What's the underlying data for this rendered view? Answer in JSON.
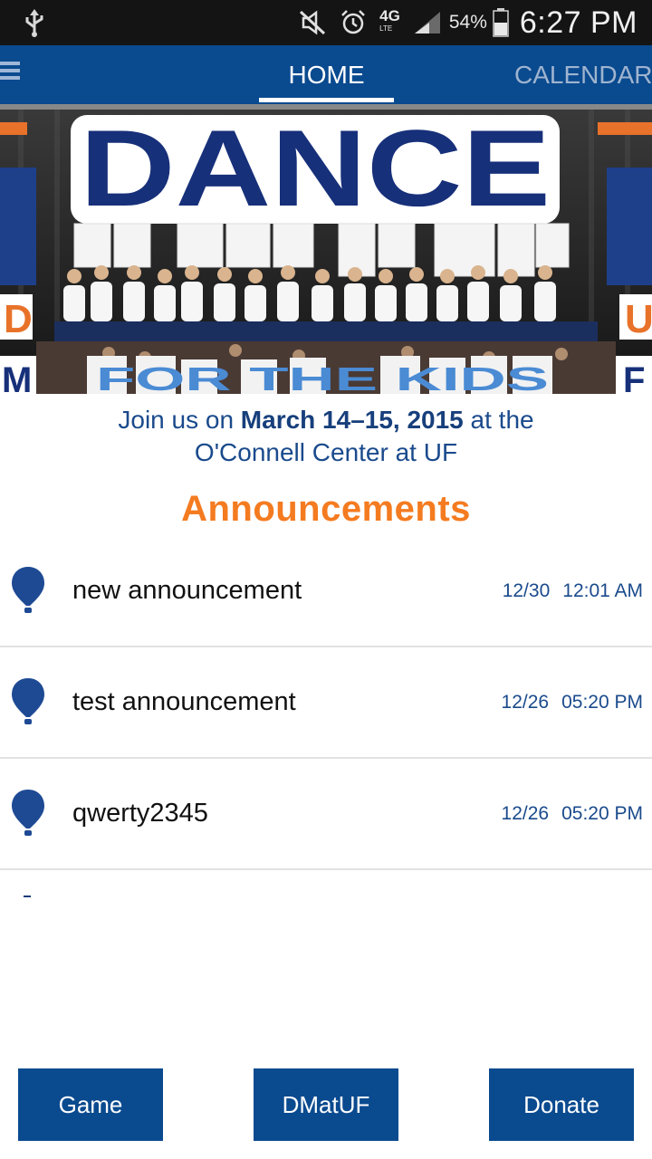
{
  "status_bar": {
    "battery_percent": "54%",
    "time": "6:27 PM",
    "network": "4G",
    "network_sub": "LTE",
    "icons": [
      "usb-icon",
      "mute-icon",
      "alarm-icon",
      "network-4g-icon",
      "signal-icon",
      "battery-icon"
    ]
  },
  "tabs": {
    "home": "HOME",
    "calendar": "CALENDAR"
  },
  "hero": {
    "banner_text": "DANCE",
    "signs_bottom": "FOR THE KIDS",
    "side_letters_left": [
      "D",
      "M"
    ],
    "side_letters_right": [
      "U",
      "F"
    ]
  },
  "event": {
    "line1_prefix": "Join us on ",
    "dates": "March 14–15, 2015",
    "line1_suffix": " at the",
    "line2": "O'Connell Center at UF"
  },
  "announcements": {
    "heading": "Announcements",
    "items": [
      {
        "title": "new announcement",
        "date": "12/30",
        "time": "12:01 AM"
      },
      {
        "title": "test announcement",
        "date": "12/26",
        "time": "05:20 PM"
      },
      {
        "title": "qwerty2345",
        "date": "12/26",
        "time": "05:20 PM"
      }
    ]
  },
  "buttons": {
    "game": "Game",
    "dmatuf": "DMatUF",
    "donate": "Donate"
  },
  "colors": {
    "primary_blue": "#0a4a8f",
    "accent_orange": "#f47b20",
    "text_blue": "#1a4a8c"
  }
}
